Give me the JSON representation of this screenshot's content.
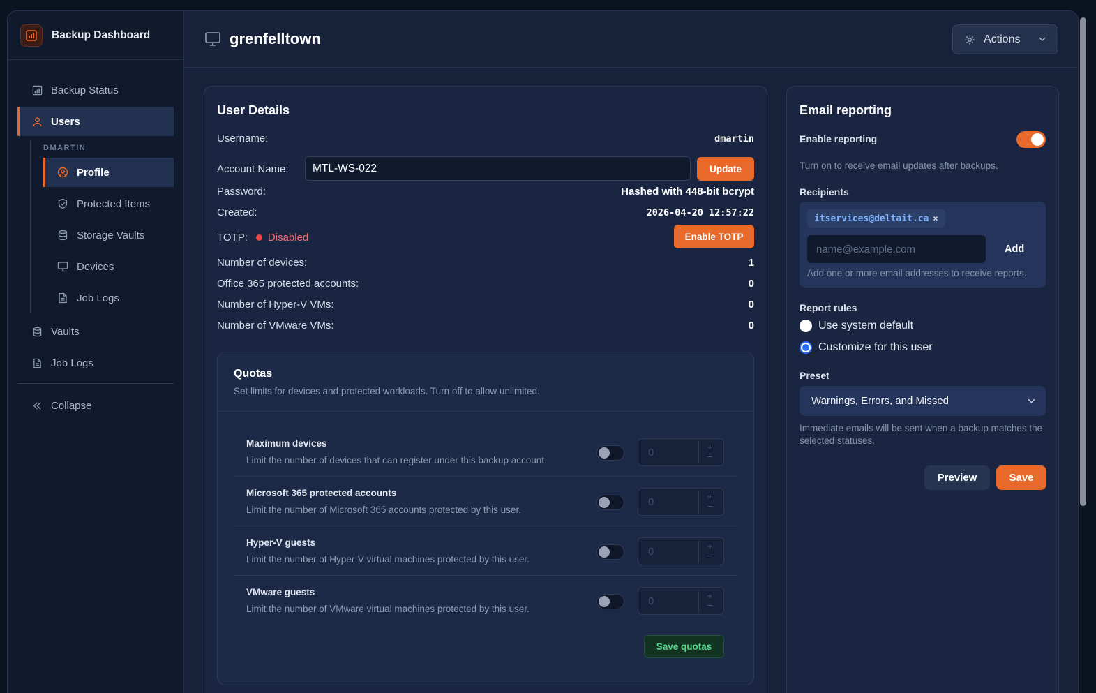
{
  "app": {
    "title": "Backup Dashboard"
  },
  "sidebar": {
    "items": [
      {
        "label": "Backup Status",
        "icon": "chart-icon"
      },
      {
        "label": "Users",
        "icon": "user-icon",
        "active": true
      },
      {
        "label": "Vaults",
        "icon": "database-icon"
      },
      {
        "label": "Job Logs",
        "icon": "file-icon"
      }
    ],
    "sub_heading": "DMARTIN",
    "sub_items": [
      {
        "label": "Profile",
        "icon": "user-circle-icon",
        "active": true
      },
      {
        "label": "Protected Items",
        "icon": "shield-icon"
      },
      {
        "label": "Storage Vaults",
        "icon": "database-icon"
      },
      {
        "label": "Devices",
        "icon": "monitor-icon"
      },
      {
        "label": "Job Logs",
        "icon": "file-icon"
      }
    ],
    "collapse_label": "Collapse"
  },
  "header": {
    "title": "grenfelltown",
    "actions_label": "Actions"
  },
  "user_details": {
    "title": "User Details",
    "username_label": "Username:",
    "username": "dmartin",
    "account_label": "Account Name:",
    "account_value": "MTL-WS-022",
    "update_label": "Update",
    "password_label": "Password:",
    "password_value": "Hashed with 448-bit bcrypt",
    "created_label": "Created:",
    "created_value": "2026-04-20 12:57:22",
    "totp_label": "TOTP:",
    "totp_status": "Disabled",
    "enable_totp_label": "Enable TOTP",
    "stats": [
      {
        "label": "Number of devices:",
        "value": "1"
      },
      {
        "label": "Office 365 protected accounts:",
        "value": "0"
      },
      {
        "label": "Number of Hyper-V VMs:",
        "value": "0"
      },
      {
        "label": "Number of VMware VMs:",
        "value": "0"
      }
    ]
  },
  "quotas": {
    "title": "Quotas",
    "subtitle": "Set limits for devices and protected workloads. Turn off to allow unlimited.",
    "rows": [
      {
        "name": "Maximum devices",
        "desc": "Limit the number of devices that can register under this backup account.",
        "value": "0",
        "enabled": false
      },
      {
        "name": "Microsoft 365 protected accounts",
        "desc": "Limit the number of Microsoft 365 accounts protected by this user.",
        "value": "0",
        "enabled": false
      },
      {
        "name": "Hyper-V guests",
        "desc": "Limit the number of Hyper-V virtual machines protected by this user.",
        "value": "0",
        "enabled": false
      },
      {
        "name": "VMware guests",
        "desc": "Limit the number of VMware virtual machines protected by this user.",
        "value": "0",
        "enabled": false
      }
    ],
    "save_label": "Save quotas"
  },
  "email": {
    "title": "Email reporting",
    "enable_label": "Enable reporting",
    "enabled": true,
    "enable_help": "Turn on to receive email updates after backups.",
    "recipients_label": "Recipients",
    "recipient_chip": "itservices@deltait.ca",
    "chip_remove": "×",
    "email_placeholder": "name@example.com",
    "add_label": "Add",
    "recipients_help": "Add one or more email addresses to receive reports.",
    "rules_label": "Report rules",
    "rule_default": "Use system default",
    "rule_custom": "Customize for this user",
    "selected_rule": "Customize for this user",
    "preset_label": "Preset",
    "preset_value": "Warnings, Errors, and Missed",
    "preset_help": "Immediate emails will be sent when a backup matches the selected statuses.",
    "preview_label": "Preview",
    "save_label": "Save"
  },
  "colors": {
    "accent": "#e8692a",
    "danger": "#ef4444",
    "success": "#54d98a",
    "link": "#7fb2ff"
  }
}
